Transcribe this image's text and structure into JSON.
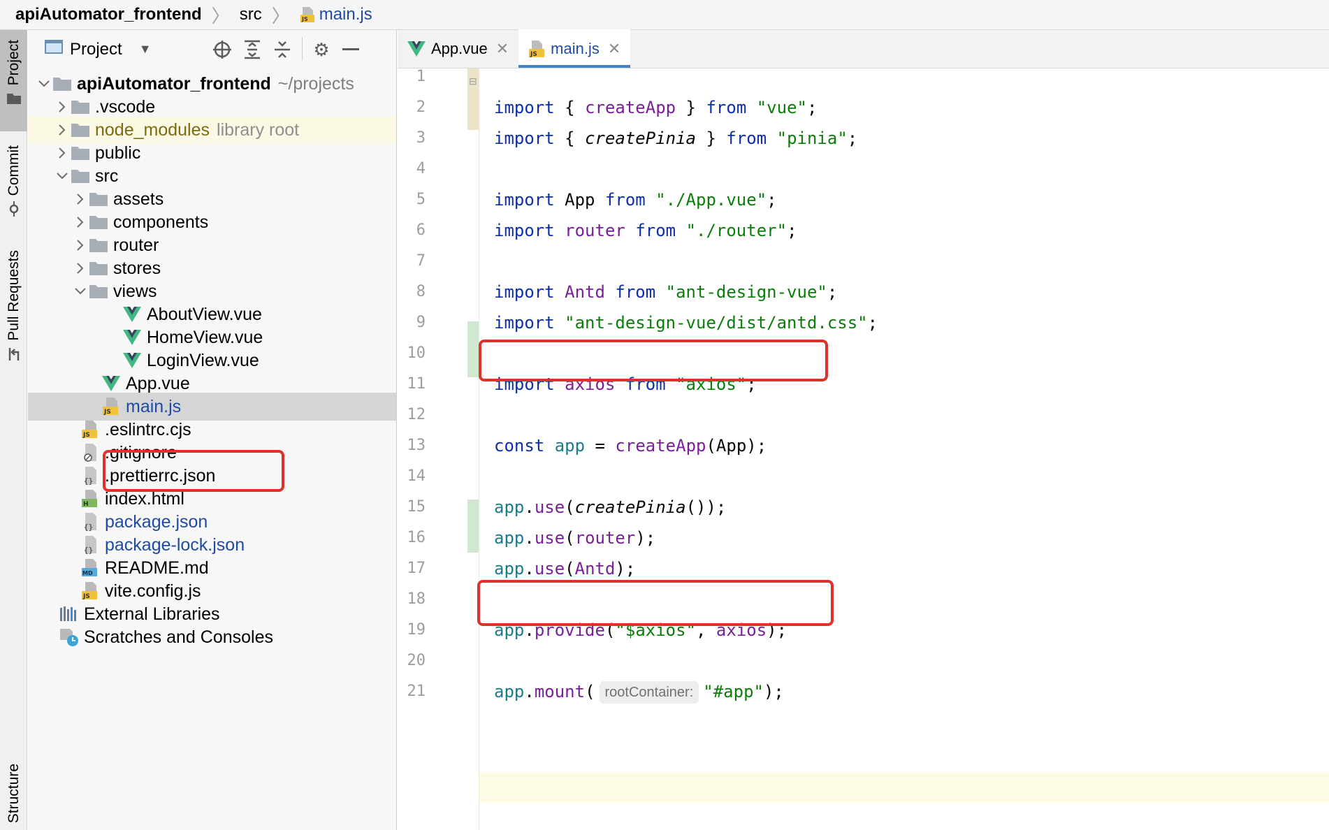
{
  "breadcrumb": {
    "root": "apiAutomator_frontend",
    "folder": "src",
    "file": "main.js"
  },
  "sidebar_tabs": {
    "project": "Project",
    "commit": "Commit",
    "pull_requests": "Pull Requests",
    "structure": "Structure"
  },
  "project_panel": {
    "title": "Project"
  },
  "tree": {
    "root_name": "apiAutomator_frontend",
    "root_path": "~/projects",
    "vscode": ".vscode",
    "node_modules": "node_modules",
    "library_root": "library root",
    "public": "public",
    "src": "src",
    "assets": "assets",
    "components": "components",
    "router": "router",
    "stores": "stores",
    "views": "views",
    "about_view": "AboutView.vue",
    "home_view": "HomeView.vue",
    "login_view": "LoginView.vue",
    "app_vue": "App.vue",
    "main_js": "main.js",
    "eslintrc": ".eslintrc.cjs",
    "gitignore": ".gitignore",
    "prettierrc": ".prettierrc.json",
    "index_html": "index.html",
    "package_json": "package.json",
    "package_lock": "package-lock.json",
    "readme": "README.md",
    "vite_config": "vite.config.js",
    "external_libraries": "External Libraries",
    "scratches": "Scratches and Consoles"
  },
  "editor_tabs": {
    "app_vue": "App.vue",
    "main_js": "main.js"
  },
  "line_numbers": [
    "1",
    "2",
    "3",
    "4",
    "5",
    "6",
    "7",
    "8",
    "9",
    "10",
    "11",
    "12",
    "13",
    "14",
    "15",
    "16",
    "17",
    "18",
    "19",
    "20",
    "21"
  ],
  "code": {
    "l1": {
      "a": "import",
      "b": " { ",
      "c": "createApp",
      "d": " } ",
      "e": "from",
      "f": " ",
      "g": "\"vue\"",
      "h": ";"
    },
    "l2": {
      "a": "import",
      "b": " { ",
      "c": "createPinia",
      "d": " } ",
      "e": "from",
      "f": " ",
      "g": "\"pinia\"",
      "h": ";"
    },
    "l4": {
      "a": "import",
      "b": " App ",
      "e": "from",
      "f": " ",
      "g": "\"./App.vue\"",
      "h": ";"
    },
    "l5": {
      "a": "import",
      "b": " ",
      "c": "router",
      "d": " ",
      "e": "from",
      "f": " ",
      "g": "\"./router\"",
      "h": ";"
    },
    "l7": {
      "a": "import",
      "b": " ",
      "c": "Antd",
      "d": " ",
      "e": "from",
      "f": " ",
      "g": "\"ant-design-vue\"",
      "h": ";"
    },
    "l8": {
      "a": "import",
      "b": " ",
      "g": "\"ant-design-vue/dist/antd.css\"",
      "h": ";"
    },
    "l10": {
      "a": "import",
      "b": " ",
      "c": "axios",
      "d": " ",
      "e": "from",
      "f": " ",
      "g": "\"axios\"",
      "h": ";"
    },
    "l12": {
      "a": "const",
      "b": " ",
      "c": "app",
      "d": " = ",
      "e": "createApp",
      "f": "(App);"
    },
    "l14": {
      "a": "app",
      "b": ".",
      "c": "use",
      "d": "(",
      "e": "createPinia",
      "f": "());"
    },
    "l15": {
      "a": "app",
      "b": ".",
      "c": "use",
      "d": "(",
      "e": "router",
      "f": ");"
    },
    "l16": {
      "a": "app",
      "b": ".",
      "c": "use",
      "d": "(",
      "e": "Antd",
      "f": ");"
    },
    "l18": {
      "a": "app",
      "b": ".",
      "c": "provide",
      "d": "(",
      "e": "\"$axios\"",
      "f": ", ",
      "g": "axios",
      "h": ");"
    },
    "l20": {
      "a": "app",
      "b": ".",
      "c": "mount",
      "d": "(",
      "hint": "rootContainer:",
      "e": "\"#app\"",
      "f": ");"
    }
  },
  "colors": {
    "keyword": "#0e2fa7",
    "string": "#0a7d0a",
    "function": "#7a1f99",
    "annotation": "#e0322c",
    "vue_green": "#41b883",
    "vue_dark": "#35495e",
    "selection": "#d5d5d5",
    "tab_underline": "#4083c9"
  },
  "icons": {
    "folder": "folder-icon",
    "vue": "vue-file-icon",
    "js": "js-file-icon",
    "json": "json-file-icon",
    "html": "html-file-icon",
    "md": "markdown-file-icon",
    "gitignore": "ignore-file-icon",
    "libraries": "external-libraries-icon",
    "scratches": "scratches-icon"
  }
}
